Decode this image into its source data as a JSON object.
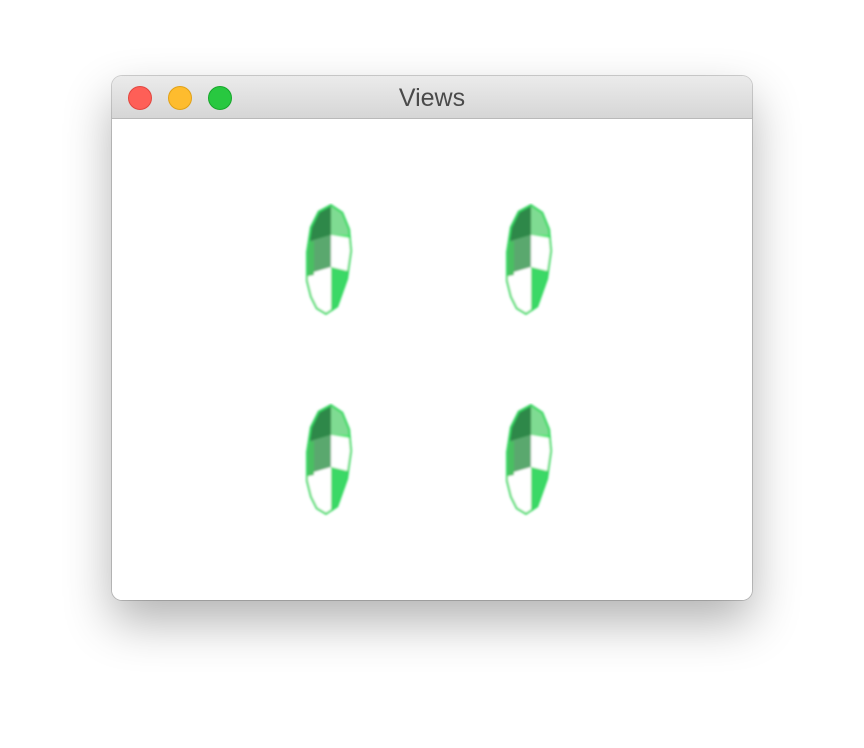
{
  "window": {
    "title": "Views"
  },
  "views": [
    {
      "shape": "gem-icon"
    },
    {
      "shape": "gem-icon"
    },
    {
      "shape": "gem-icon"
    },
    {
      "shape": "gem-icon"
    }
  ],
  "colors": {
    "close": "#fe5f57",
    "minimize": "#febc2e",
    "maximize": "#28c840",
    "gem_dark": "#2e8a4a",
    "gem_bright": "#3fe06a",
    "gem_light": "#ffffff"
  }
}
